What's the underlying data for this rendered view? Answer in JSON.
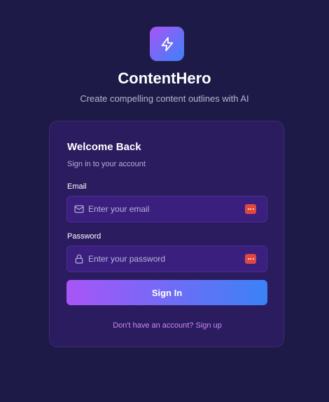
{
  "app": {
    "title": "ContentHero",
    "subtitle": "Create compelling content outlines with AI",
    "logo_icon": "lightning-bolt-icon"
  },
  "login_card": {
    "title": "Welcome Back",
    "subtitle": "Sign in to your account",
    "email": {
      "label": "Email",
      "value": "",
      "placeholder": "Enter your email",
      "icon": "mail-icon"
    },
    "password": {
      "label": "Password",
      "value": "",
      "placeholder": "Enter your password",
      "icon": "lock-icon"
    },
    "password_manager_icon": "password-manager-icon",
    "submit_label": "Sign In",
    "signup_link": "Don't have an account? Sign up"
  },
  "colors": {
    "background": "#1e1a47",
    "card": "#2b1c60",
    "input": "#3a1f7e",
    "gradient_start": "#a855f7",
    "gradient_end": "#3b82f6",
    "link": "#c78bf7",
    "password_manager": "#e0483f"
  }
}
